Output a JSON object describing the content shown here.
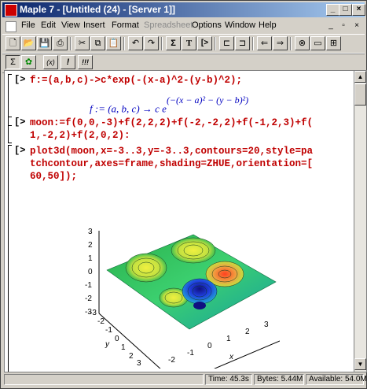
{
  "window": {
    "title": "Maple 7 - [Untitled (24) - [Server 1]]",
    "buttons": {
      "minimize": "_",
      "maximize": "□",
      "close": "×"
    }
  },
  "menu": {
    "items": [
      "File",
      "Edit",
      "View",
      "Insert",
      "Format",
      "Spreadsheet",
      "Options",
      "Window",
      "Help"
    ],
    "disabled": [
      "Spreadsheet"
    ]
  },
  "toolbar": {
    "icons": [
      "new-icon",
      "open-icon",
      "save-icon",
      "print-icon",
      "cut-icon",
      "copy-icon",
      "paste-icon",
      "undo-icon",
      "redo-icon",
      "text-mode-icon",
      "math-text-icon",
      "insert-prompt-icon",
      "group-icon",
      "ungroup-icon",
      "indent-left-icon",
      "indent-right-icon",
      "back-icon",
      "forward-icon",
      "stop-icon",
      "restart-icon",
      "zoom-icon"
    ],
    "text_mode": "Σ",
    "math_text": "T",
    "insert_prompt": "[>"
  },
  "context_bar": {
    "symbol": "(x)",
    "exclaim": "!",
    "exclaim_all": "!!!"
  },
  "worksheet": {
    "prompt": "[>",
    "commands": [
      "f:=(a,b,c)->c*exp(-(x-a)^2-(y-b)^2);",
      "moon:=f(0,0,-3)+f(2,2,2)+f(-2,-2,2)+f(-1,2,3)+f(\n1,-2,2)+f(2,0,2):",
      "plot3d(moon,x=-3..3,y=-3..3,contours=20,style=pa\ntchcontour,axes=frame,shading=ZHUE,orientation=[\n60,50]);"
    ],
    "output": {
      "lhs": "f := (a, b, c) → c e",
      "exponent": "(−(x − a)² − (y − b)²)"
    }
  },
  "plot": {
    "z_ticks": [
      "3",
      "2",
      "1",
      "0",
      "-1",
      "-2",
      "-3"
    ],
    "y_ticks": [
      "-3",
      "-2",
      "-1",
      "0",
      "1",
      "2",
      "3"
    ],
    "x_ticks": [
      "-2",
      "-1",
      "0",
      "1",
      "2",
      "3"
    ],
    "y_label": "y",
    "x_label": "x"
  },
  "status": {
    "time": "Time: 45.3s",
    "bytes": "Bytes: 5.44M",
    "available": "Available: 54.0M"
  }
}
